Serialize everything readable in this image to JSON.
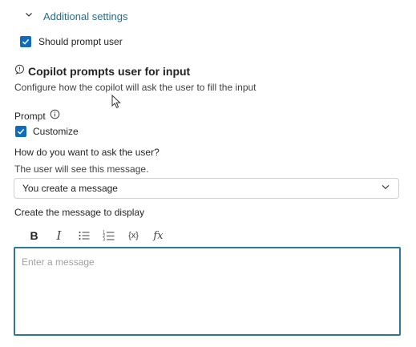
{
  "additional_settings": {
    "label": "Additional settings"
  },
  "should_prompt_user": {
    "label": "Should prompt user",
    "checked": true
  },
  "section": {
    "title": "Copilot prompts user for input",
    "description": "Configure how the copilot will ask the user to fill the input"
  },
  "prompt": {
    "label": "Prompt",
    "customize_label": "Customize",
    "customize_checked": true
  },
  "ask": {
    "question": "How do you want to ask the user?",
    "hint": "The user will see this message.",
    "select_value": "You create a message"
  },
  "message": {
    "label": "Create the message to display",
    "placeholder": "Enter a message"
  },
  "toolbar": {
    "bold": "B",
    "italic": "I",
    "variable": "{x}",
    "formula": "fx"
  },
  "colors": {
    "accent": "#0f6cbd",
    "link": "#2a6a8a",
    "focus_border": "#2a7a95"
  }
}
